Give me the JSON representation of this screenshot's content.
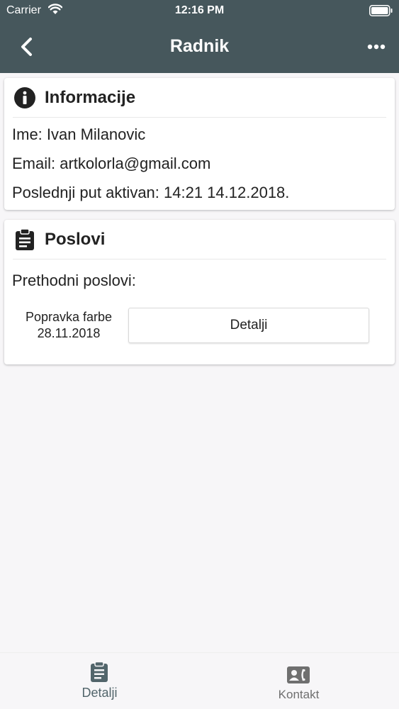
{
  "status_bar": {
    "carrier": "Carrier",
    "time": "12:16 PM"
  },
  "nav": {
    "title": "Radnik",
    "back_icon": "chevron-left-icon",
    "more_icon": "ellipsis-icon"
  },
  "info_card": {
    "icon": "info-icon",
    "title": "Informacije",
    "name_line": "Ime: Ivan Milanovic",
    "email_line": "Email: artkolorla@gmail.com",
    "last_active_line": "Poslednji put aktivan: 14:21 14.12.2018."
  },
  "jobs_card": {
    "icon": "clipboard-icon",
    "title": "Poslovi",
    "previous_label": "Prethodni poslovi:",
    "jobs": [
      {
        "name": "Popravka farbe",
        "date": "28.11.2018",
        "button_label": "Detalji"
      }
    ]
  },
  "tabbar": {
    "tabs": [
      {
        "label": "Detalji",
        "icon": "clipboard-icon",
        "active": true
      },
      {
        "label": "Kontakt",
        "icon": "contact-card-icon",
        "active": false
      }
    ]
  },
  "colors": {
    "header_bg": "#46575c",
    "active_tab": "#52656b",
    "inactive_tab": "#6f6f6f",
    "page_bg": "#f7f6f8"
  }
}
